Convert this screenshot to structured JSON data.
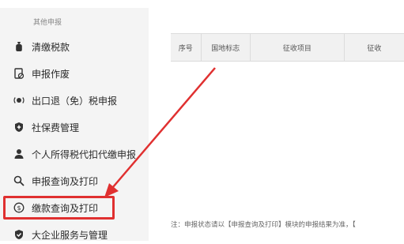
{
  "sidebar": {
    "section_title": "其他申报",
    "items": [
      {
        "label": "清缴税款",
        "icon": "money-bag-icon"
      },
      {
        "label": "申报作废",
        "icon": "document-void-icon"
      },
      {
        "label": "出口退（免）税申报",
        "icon": "export-refund-icon"
      },
      {
        "label": "社保费管理",
        "icon": "shield-icon"
      },
      {
        "label": "个人所得税代扣代缴申报",
        "icon": "user-icon"
      },
      {
        "label": "申报查询及打印",
        "icon": "search-icon"
      },
      {
        "label": "缴款查询及打印",
        "icon": "payment-circle-icon"
      },
      {
        "label": "大企业服务与管理",
        "icon": "shield-icon"
      }
    ]
  },
  "table": {
    "headers": [
      "序号",
      "国地标志",
      "征收项目",
      "征收"
    ]
  },
  "note": "注：申报状态请以【申报查询及打印】模块的申报结果为准，【",
  "colors": {
    "highlight": "#e03030",
    "arrow": "#e03030",
    "sidebar_bg": "#f4f4f4",
    "header_bg": "#f1f1f1"
  }
}
